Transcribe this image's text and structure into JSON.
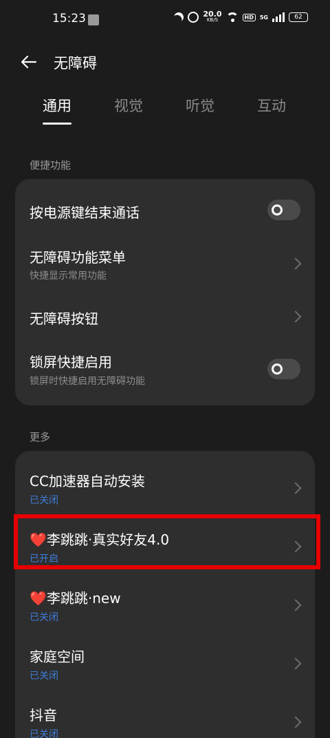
{
  "status_bar": {
    "time": "15:23",
    "speed_value": "20.0",
    "speed_unit": "KB/S",
    "hd": "HD",
    "network": "5G",
    "battery": "62"
  },
  "header": {
    "title": "无障碍"
  },
  "tabs": [
    {
      "label": "通用",
      "active": true
    },
    {
      "label": "视觉",
      "active": false
    },
    {
      "label": "听觉",
      "active": false
    },
    {
      "label": "互动",
      "active": false
    }
  ],
  "sections": {
    "shortcuts": {
      "title": "便捷功能",
      "items": [
        {
          "title": "按电源键结束通话",
          "subtitle": "",
          "control": "toggle",
          "state": "off"
        },
        {
          "title": "无障碍功能菜单",
          "subtitle": "快捷显示常用功能",
          "control": "chevron"
        },
        {
          "title": "无障碍按钮",
          "subtitle": "",
          "control": "chevron"
        },
        {
          "title": "锁屏快捷启用",
          "subtitle": "锁屏时快捷启用无障碍功能",
          "control": "toggle",
          "state": "off"
        }
      ]
    },
    "more": {
      "title": "更多",
      "items": [
        {
          "title": "CC加速器自动安装",
          "subtitle": "已关闭",
          "control": "chevron"
        },
        {
          "title": "❤️李跳跳·真实好友4.0",
          "subtitle": "已开启",
          "control": "chevron",
          "highlighted": true
        },
        {
          "title": "❤️李跳跳·new",
          "subtitle": "已关闭",
          "control": "chevron"
        },
        {
          "title": "家庭空间",
          "subtitle": "已关闭",
          "control": "chevron"
        },
        {
          "title": "抖音",
          "subtitle": "已关闭",
          "control": "chevron"
        }
      ]
    }
  },
  "colors": {
    "background": "#1c1c1c",
    "card": "#2e2e2e",
    "status_blue": "#3f7ddb",
    "highlight_red": "#e60000"
  },
  "icons": {
    "back": "arrow-left-icon",
    "chevron": "chevron-right-icon",
    "toggle": "toggle-switch"
  }
}
